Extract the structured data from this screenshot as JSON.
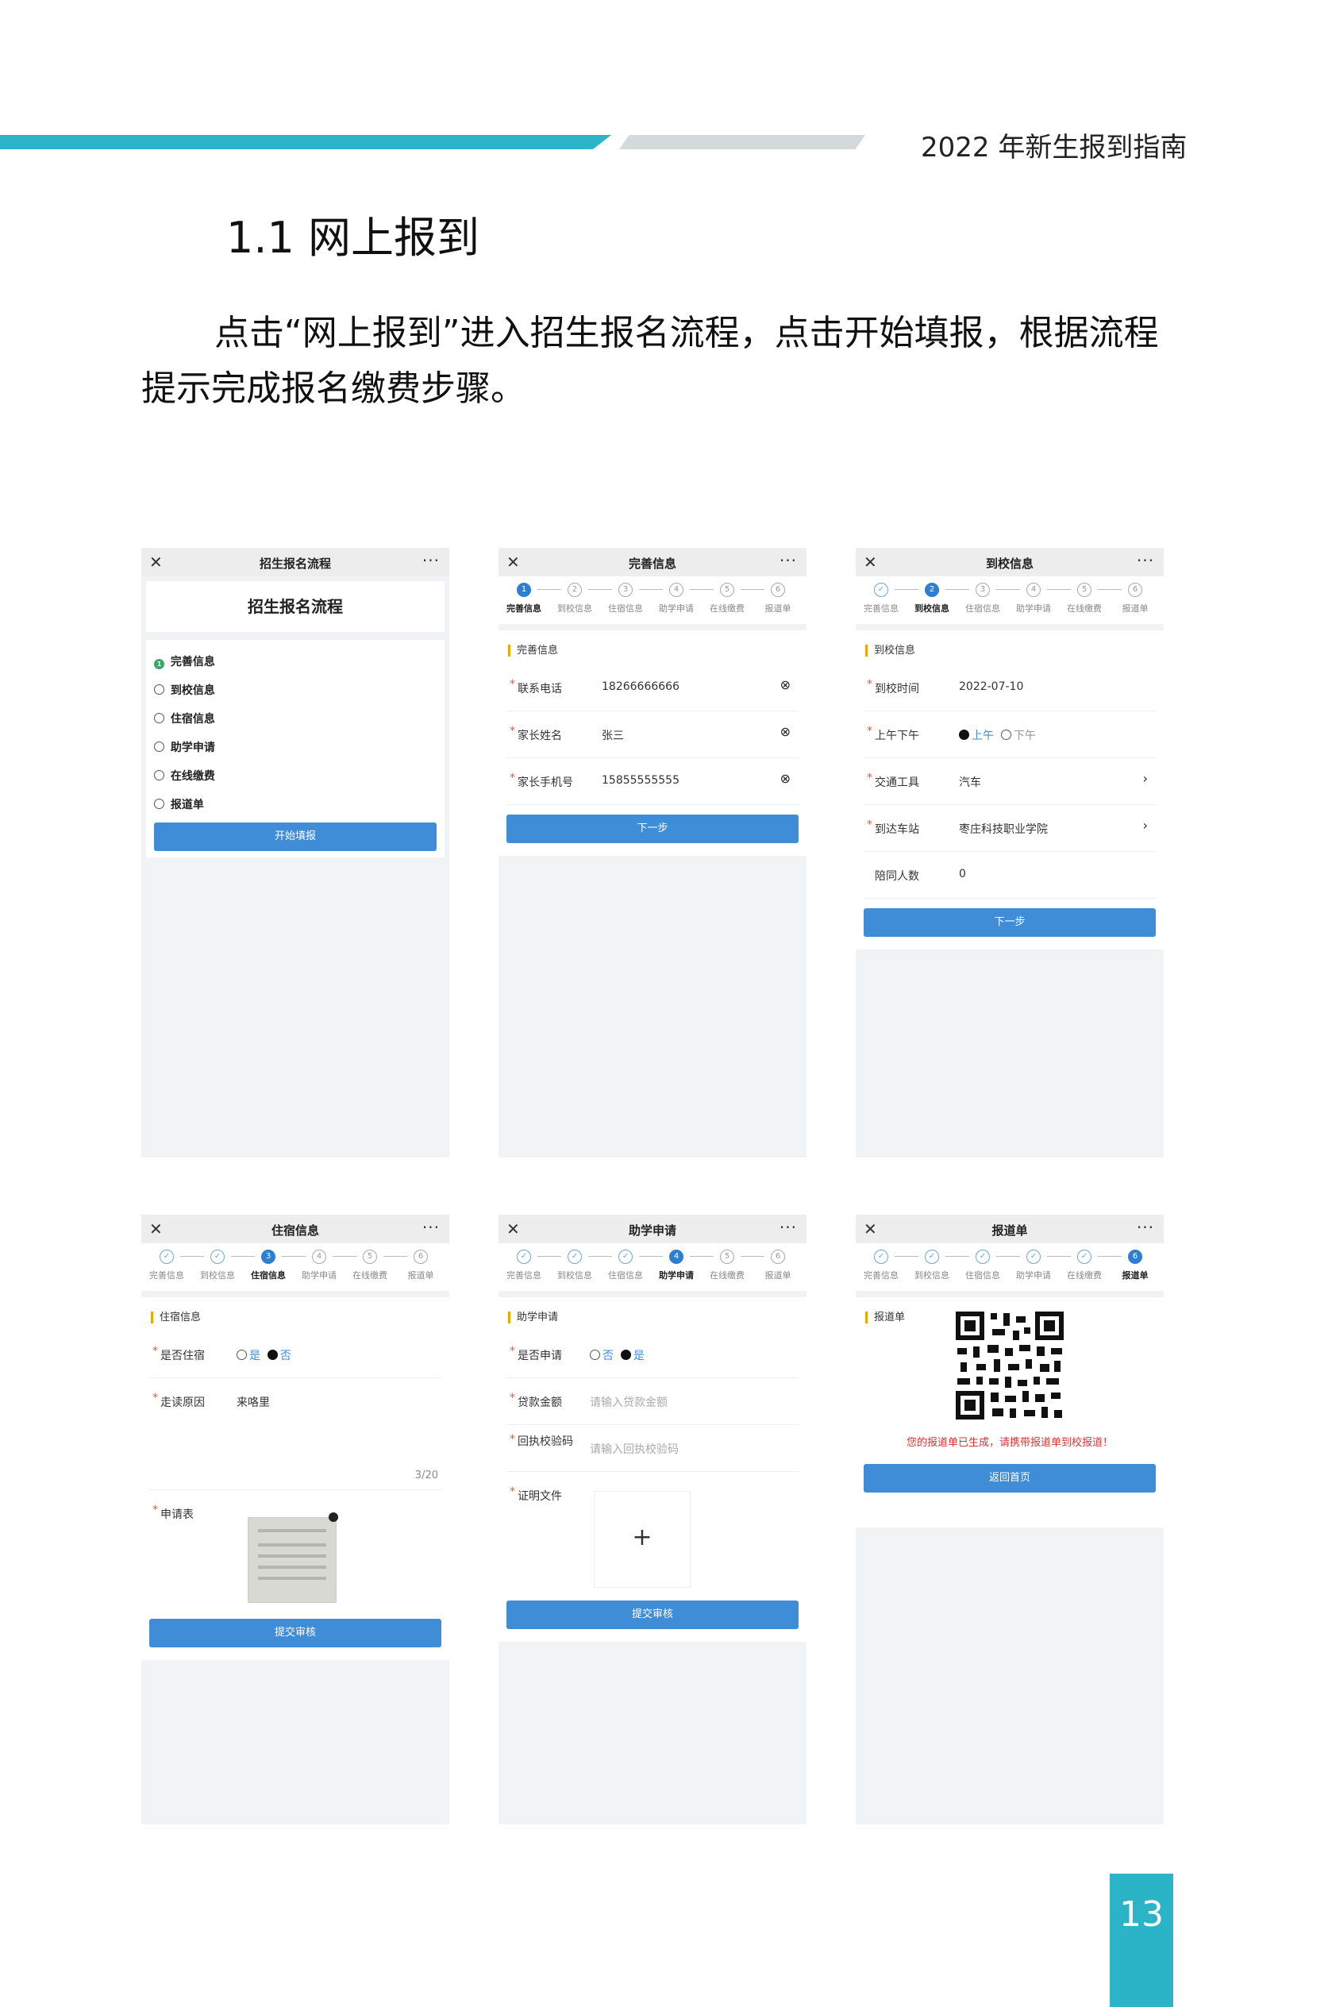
{
  "header": {
    "guide_title": "2022 年新生报到指南"
  },
  "section": {
    "title": "1.1 网上报到",
    "paragraph": "点击“网上报到”进入招生报名流程，点击开始填报，根据流程提示完成报名缴费步骤。"
  },
  "page_number": "13",
  "steps": [
    "完善信息",
    "到校信息",
    "住宿信息",
    "助学申请",
    "在线缴费",
    "报道单"
  ],
  "phone1": {
    "nav_title": "招生报名流程",
    "heading": "招生报名流程",
    "items": [
      "完善信息",
      "到校信息",
      "住宿信息",
      "助学申请",
      "在线缴费",
      "报道单"
    ],
    "button": "开始填报"
  },
  "phone2": {
    "nav_title": "完善信息",
    "section": "完善信息",
    "fields": [
      {
        "label": "联系电话",
        "value": "18266666666"
      },
      {
        "label": "家长姓名",
        "value": "张三"
      },
      {
        "label": "家长手机号",
        "value": "15855555555"
      }
    ],
    "button": "下一步"
  },
  "phone3": {
    "nav_title": "到校信息",
    "section": "到校信息",
    "date_label": "到校时间",
    "date_value": "2022-07-10",
    "ampm_label": "上午下午",
    "am": "上午",
    "pm": "下午",
    "transport_label": "交通工具",
    "transport_value": "汽车",
    "station_label": "到达车站",
    "station_value": "枣庄科技职业学院",
    "companion_label": "陪同人数",
    "companion_value": "0",
    "button": "下一步"
  },
  "phone4": {
    "nav_title": "住宿信息",
    "section": "住宿信息",
    "stay_label": "是否住宿",
    "yes": "是",
    "no": "否",
    "reason_label": "走读原因",
    "reason_value": "来咯里",
    "counter": "3/20",
    "form_label": "申请表",
    "button": "提交审核"
  },
  "phone5": {
    "nav_title": "助学申请",
    "section": "助学申请",
    "apply_label": "是否申请",
    "no": "否",
    "yes": "是",
    "loan_label": "贷款金额",
    "loan_placeholder": "请输入贷款金额",
    "code_label": "回执校验码",
    "code_placeholder": "请输入回执校验码",
    "doc_label": "证明文件",
    "button": "提交审核"
  },
  "phone6": {
    "nav_title": "报道单",
    "section": "报道单",
    "notice": "您的报道单已生成，请携带报道单到校报道！",
    "button": "返回首页"
  }
}
